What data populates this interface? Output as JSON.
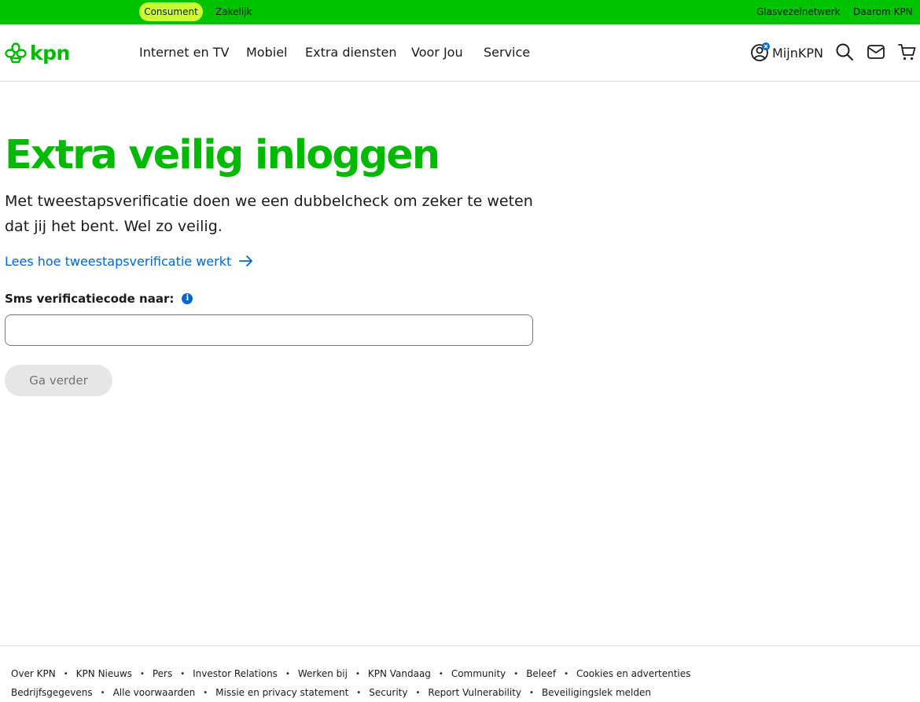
{
  "topbar": {
    "segments": [
      {
        "label": "Consument",
        "active": true
      },
      {
        "label": "Zakelijk",
        "active": false
      }
    ],
    "links": [
      "Glasvezelnetwerk",
      "Daarom KPN"
    ]
  },
  "header": {
    "logo_text": "kpn",
    "nav": [
      "Internet en TV",
      "Mobiel",
      "Extra diensten",
      "Voor Jou",
      "Service"
    ],
    "account_label": "MijnKPN",
    "icons": [
      "user-icon",
      "search-icon",
      "mail-icon",
      "cart-icon"
    ]
  },
  "main": {
    "title": "Extra veilig inloggen",
    "intro": "Met tweestapsverificatie doen we een dubbelcheck om zeker te weten dat jij het bent. Wel zo veilig.",
    "learn_link": "Lees hoe tweestapsverificatie werkt",
    "field_label": "Sms verificatiecode naar:",
    "info_glyph": "i",
    "code_value": "",
    "continue_label": "Ga verder"
  },
  "footer": {
    "row1": [
      "Over KPN",
      "KPN Nieuws",
      "Pers",
      "Investor Relations",
      "Werken bij",
      "KPN Vandaag",
      "Community",
      "Beleef",
      "Cookies en advertenties"
    ],
    "row2": [
      "Bedrijfsgegevens",
      "Alle voorwaarden",
      "Missie en privacy statement",
      "Security",
      "Report Vulnerability",
      "Beveiligingslek melden"
    ]
  },
  "colors": {
    "brand_green": "#00c300",
    "title_green": "#00b900",
    "active_pill": "#ccff33",
    "link_blue": "#0066cc",
    "button_disabled_bg": "#e6e6e6"
  }
}
